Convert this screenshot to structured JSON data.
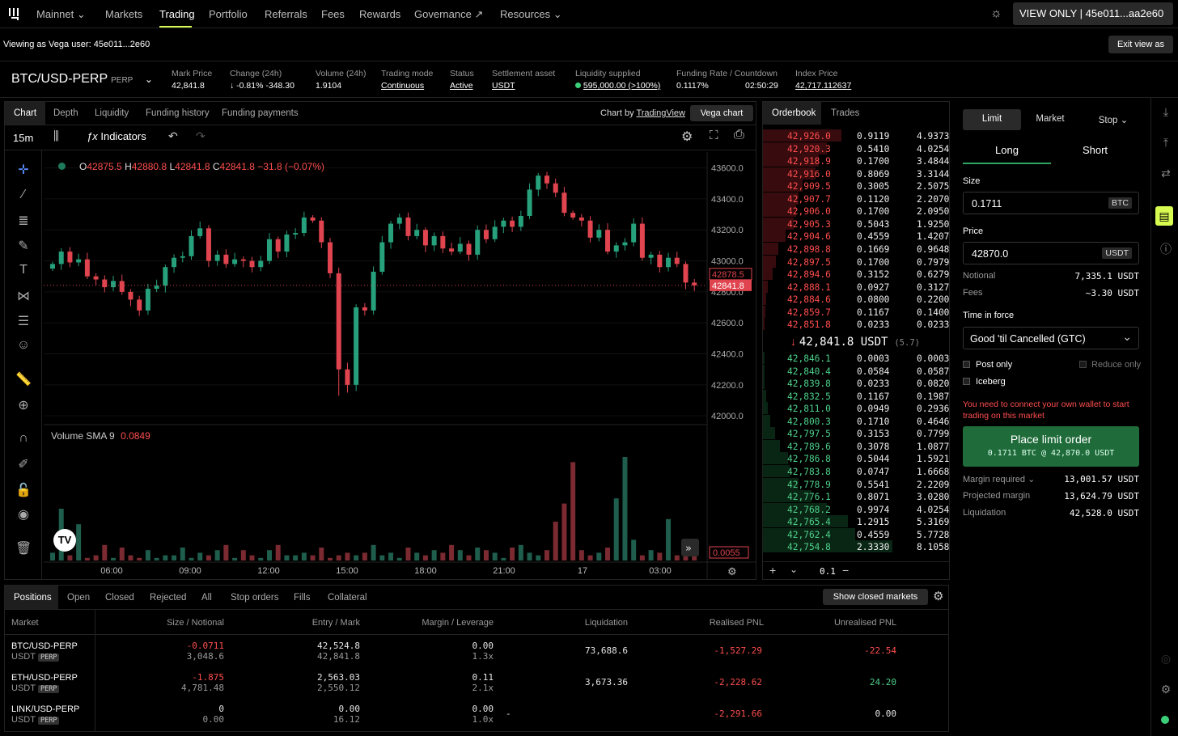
{
  "nav": {
    "items": [
      "Mainnet",
      "Markets",
      "Trading",
      "Portfolio",
      "Referrals",
      "Fees",
      "Rewards",
      "Governance",
      "Resources"
    ],
    "view_only": "VIEW ONLY | 45e011...aa2e60"
  },
  "viewbar": {
    "text": "Viewing as Vega user: 45e011...2e60",
    "exit": "Exit view as"
  },
  "market": {
    "name": "BTC/USD-PERP",
    "tag": "PERP",
    "stats": [
      {
        "label": "Mark Price",
        "value": "42,841.8"
      },
      {
        "label": "Change (24h)",
        "value": "↓ -0.81% -348.30"
      },
      {
        "label": "Volume (24h)",
        "value": "1.9104"
      },
      {
        "label": "Trading mode",
        "value": "Continuous"
      },
      {
        "label": "Status",
        "value": "Active"
      },
      {
        "label": "Settlement asset",
        "value": "USDT"
      },
      {
        "label": "Liquidity supplied",
        "value": "595,000.00 (>100%)"
      },
      {
        "label": "Funding Rate / Countdown",
        "value": "0.1117%",
        "value2": "02:50:29"
      },
      {
        "label": "Index Price",
        "value": "42,717.112637"
      }
    ]
  },
  "chart": {
    "tabs": [
      "Chart",
      "Depth",
      "Liquidity",
      "Funding history",
      "Funding payments"
    ],
    "chart_by": "Chart by",
    "tradingview": "TradingView",
    "vega_chart": "Vega chart",
    "interval": "15m",
    "indicators": "Indicators",
    "ohlc": {
      "o": "42875.5",
      "h": "42880.8",
      "l": "42841.8",
      "c": "42841.8",
      "chg": "−31.8 (−0.07%)"
    },
    "volume_label": "Volume SMA 9",
    "volume_val": "0.0849",
    "price_tags": [
      "42878.5",
      "42841.8"
    ],
    "vol_tag": "0.0055"
  },
  "chart_data": {
    "type": "candlestick",
    "y_ticks": [
      43600,
      43400,
      43200,
      43000,
      42800,
      42600,
      42400,
      42200,
      42000
    ],
    "x_ticks": [
      "06:00",
      "09:00",
      "12:00",
      "15:00",
      "18:00",
      "21:00",
      "17",
      "03:00"
    ],
    "closes": [
      42980,
      43060,
      42990,
      43010,
      42900,
      42880,
      42830,
      42870,
      42800,
      42750,
      42680,
      42820,
      42840,
      42960,
      43020,
      43030,
      43160,
      43210,
      43000,
      43040,
      42980,
      43010,
      43000,
      42960,
      43000,
      43140,
      43060,
      43170,
      43180,
      43280,
      43260,
      43120,
      42920,
      42300,
      42200,
      42700,
      42680,
      42930,
      43120,
      43240,
      43280,
      43160,
      43200,
      43100,
      43160,
      43080,
      43060,
      43110,
      43040,
      43200,
      43140,
      43220,
      43260,
      43220,
      43290,
      43460,
      43550,
      43500,
      43440,
      43310,
      43280,
      43260,
      43150,
      43200,
      43060,
      43100,
      43120,
      43240,
      43020,
      43040,
      42960,
      43020,
      42980,
      42860,
      42841.8
    ]
  },
  "orderbook": {
    "tabs": [
      "Orderbook",
      "Trades"
    ],
    "asks": [
      [
        "42,926.0",
        "0.9119",
        "4.9373"
      ],
      [
        "42,920.3",
        "0.5410",
        "4.0254"
      ],
      [
        "42,918.9",
        "0.1700",
        "3.4844"
      ],
      [
        "42,916.0",
        "0.8069",
        "3.3144"
      ],
      [
        "42,909.5",
        "0.3005",
        "2.5075"
      ],
      [
        "42,907.7",
        "0.1120",
        "2.2070"
      ],
      [
        "42,906.0",
        "0.1700",
        "2.0950"
      ],
      [
        "42,905.3",
        "0.5043",
        "1.9250"
      ],
      [
        "42,904.6",
        "0.4559",
        "1.4207"
      ],
      [
        "42,898.8",
        "0.1669",
        "0.9648"
      ],
      [
        "42,897.5",
        "0.1700",
        "0.7979"
      ],
      [
        "42,894.6",
        "0.3152",
        "0.6279"
      ],
      [
        "42,888.1",
        "0.0927",
        "0.3127"
      ],
      [
        "42,884.6",
        "0.0800",
        "0.2200"
      ],
      [
        "42,859.7",
        "0.1167",
        "0.1400"
      ],
      [
        "42,851.8",
        "0.0233",
        "0.0233"
      ]
    ],
    "mid": "42,841.8 USDT",
    "spread": "(5.7)",
    "bids": [
      [
        "42,846.1",
        "0.0003",
        "0.0003"
      ],
      [
        "42,840.4",
        "0.0584",
        "0.0587"
      ],
      [
        "42,839.8",
        "0.0233",
        "0.0820"
      ],
      [
        "42,832.5",
        "0.1167",
        "0.1987"
      ],
      [
        "42,811.0",
        "0.0949",
        "0.2936"
      ],
      [
        "42,800.3",
        "0.1710",
        "0.4646"
      ],
      [
        "42,797.5",
        "0.3153",
        "0.7799"
      ],
      [
        "42,789.6",
        "0.3078",
        "1.0877"
      ],
      [
        "42,786.8",
        "0.5044",
        "1.5921"
      ],
      [
        "42,783.8",
        "0.0747",
        "1.6668"
      ],
      [
        "42,778.9",
        "0.5541",
        "2.2209"
      ],
      [
        "42,776.1",
        "0.8071",
        "3.0280"
      ],
      [
        "42,768.2",
        "0.9974",
        "4.0254"
      ],
      [
        "42,765.4",
        "1.2915",
        "5.3169"
      ],
      [
        "42,762.4",
        "0.4559",
        "5.7728"
      ],
      [
        "42,754.8",
        "2.3330",
        "8.1058"
      ]
    ],
    "resolution": "0.1"
  },
  "ticket": {
    "types": [
      "Limit",
      "Market",
      "Stop"
    ],
    "sides": [
      "Long",
      "Short"
    ],
    "size_label": "Size",
    "size": "0.1711",
    "size_unit": "BTC",
    "price_label": "Price",
    "price": "42870.0",
    "price_unit": "USDT",
    "notional_label": "Notional",
    "notional": "7,335.1 USDT",
    "fees_label": "Fees",
    "fees": "~3.30 USDT",
    "tif_label": "Time in force",
    "tif": "Good 'til Cancelled (GTC)",
    "post_only": "Post only",
    "reduce_only": "Reduce only",
    "iceberg": "Iceberg",
    "warning": "You need to connect your own wallet to start trading on this market",
    "place": "Place limit order",
    "place_sub": "0.1711 BTC @ 42,870.0 USDT",
    "margin_label": "Margin required",
    "margin": "13,001.57 USDT",
    "proj_label": "Projected margin",
    "proj": "13,624.79 USDT",
    "liq_label": "Liquidation",
    "liq": "42,528.0 USDT"
  },
  "positions": {
    "tabs": [
      "Positions",
      "Open",
      "Closed",
      "Rejected",
      "All",
      "Stop orders",
      "Fills",
      "Collateral"
    ],
    "show_closed": "Show closed markets",
    "headers": [
      "Market",
      "Size / Notional",
      "Entry / Mark",
      "Margin / Leverage",
      "Liquidation",
      "Realised PNL",
      "Unrealised PNL"
    ],
    "rows": [
      {
        "market": "BTC/USD-PERP",
        "asset": "USDT",
        "tag": "PERP",
        "size": "-0.0711",
        "notional": "3,048.6",
        "entry": "42,524.8",
        "mark": "42,841.8",
        "margin": "0.00",
        "lev": "1.3x",
        "liq": "73,688.6",
        "rpnl": "-1,527.29",
        "upnl": "-22.54"
      },
      {
        "market": "ETH/USD-PERP",
        "asset": "USDT",
        "tag": "PERP",
        "size": "-1.875",
        "notional": "4,781.48",
        "entry": "2,563.03",
        "mark": "2,550.12",
        "margin": "0.11",
        "lev": "2.1x",
        "liq": "3,673.36",
        "rpnl": "-2,228.62",
        "upnl": "24.20"
      },
      {
        "market": "LINK/USD-PERP",
        "asset": "USDT",
        "tag": "PERP",
        "size": "0",
        "notional": "0.00",
        "entry": "0.00",
        "mark": "16.12",
        "margin": "0.00",
        "lev": "1.0x",
        "liq": "-",
        "rpnl": "-2,291.66",
        "upnl": "0.00"
      }
    ]
  }
}
